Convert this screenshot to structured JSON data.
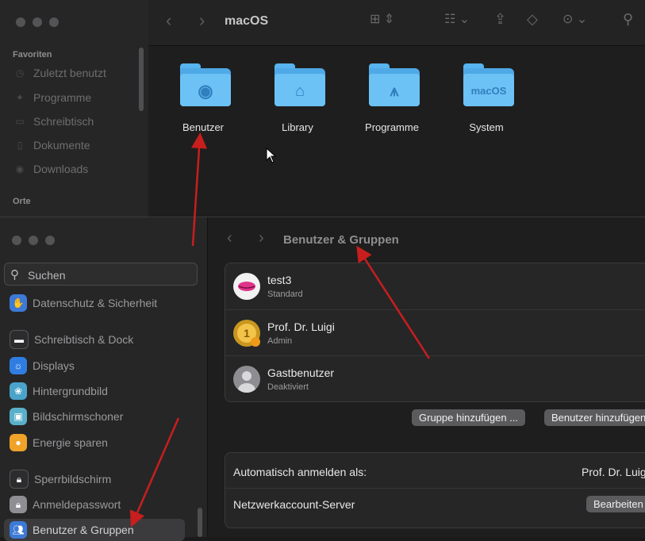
{
  "finder": {
    "title": "macOS",
    "sidebar": {
      "favorites_heading": "Favoriten",
      "favorites": [
        {
          "label": "Zuletzt benutzt",
          "icon": "clock-icon"
        },
        {
          "label": "Programme",
          "icon": "apps-icon"
        },
        {
          "label": "Schreibtisch",
          "icon": "desktop-icon"
        },
        {
          "label": "Dokumente",
          "icon": "document-icon"
        },
        {
          "label": "Downloads",
          "icon": "download-icon"
        }
      ],
      "places_heading": "Orte"
    },
    "folders": [
      {
        "label": "Benutzer",
        "icon": "user-folder-icon"
      },
      {
        "label": "Library",
        "icon": "library-folder-icon"
      },
      {
        "label": "Programme",
        "icon": "applications-folder-icon"
      },
      {
        "label": "System",
        "icon": "macos-folder-icon",
        "emblem_text": "macOS"
      }
    ]
  },
  "settings": {
    "search_placeholder": "Suchen",
    "page_title": "Benutzer & Gruppen",
    "sidebar": [
      {
        "label": "Datenschutz & Sicherheit",
        "icon": "hand-icon",
        "color": "#3d7ad6"
      },
      {
        "label": "Schreibtisch & Dock",
        "icon": "dock-icon",
        "color": "#2c2c2e"
      },
      {
        "label": "Displays",
        "icon": "sun-icon",
        "color": "#2f7de1"
      },
      {
        "label": "Hintergrundbild",
        "icon": "flower-icon",
        "color": "#4aa3c9"
      },
      {
        "label": "Bildschirmschoner",
        "icon": "screensaver-icon",
        "color": "#5ab0c8"
      },
      {
        "label": "Energie sparen",
        "icon": "lightbulb-icon",
        "color": "#f0a229"
      },
      {
        "label": "Sperrbildschirm",
        "icon": "lock-screen-icon",
        "color": "#2c2c2e"
      },
      {
        "label": "Anmeldepasswort",
        "icon": "lock-icon",
        "color": "#8e8e93"
      },
      {
        "label": "Benutzer & Gruppen",
        "icon": "users-icon",
        "color": "#3d7ad6",
        "active": true
      }
    ],
    "users": [
      {
        "name": "test3",
        "role": "Standard",
        "avatar": "lips-avatar"
      },
      {
        "name": "Prof. Dr. Luigi",
        "role": "Admin",
        "avatar": "medal-avatar"
      },
      {
        "name": "Gastbenutzer",
        "role": "Deaktiviert",
        "avatar": "guest-avatar"
      }
    ],
    "buttons": {
      "add_group": "Gruppe hinzufügen ...",
      "add_user": "Benutzer hinzufügen ..."
    },
    "options": [
      {
        "label": "Automatisch anmelden als:",
        "value": "Prof. Dr. Luigi"
      },
      {
        "label": "Netzwerkaccount-Server",
        "button": "Bearbeiten ..."
      }
    ]
  },
  "annotation_color": "#c81e1e"
}
